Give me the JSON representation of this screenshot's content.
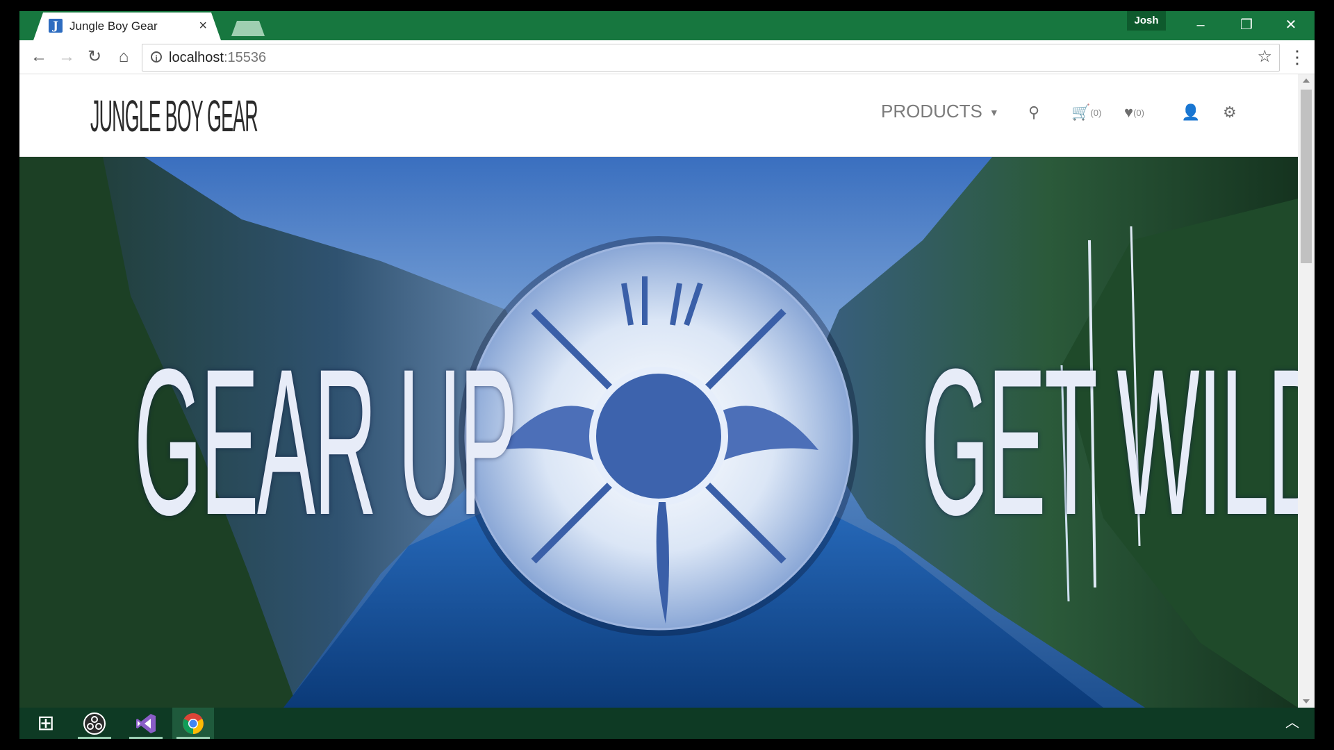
{
  "browser": {
    "tab_title": "Jungle Boy Gear",
    "tab_favicon_letter": "J",
    "tab_close": "×",
    "profile_name": "Josh",
    "url_host": "localhost",
    "url_port": ":15536",
    "window_controls": {
      "minimize": "–",
      "maximize": "❐",
      "close": "✕"
    }
  },
  "toolbar_icons": {
    "back": "←",
    "forward": "→",
    "reload": "↻",
    "home": "⌂",
    "info": "i",
    "bookmark": "☆",
    "menu": "⋮"
  },
  "site": {
    "logo": "JUNGLE BOY GEAR",
    "nav": {
      "products_label": "PRODUCTS",
      "products_caret": "▼",
      "search_icon": "⚲",
      "cart_icon": "🛒",
      "cart_count": "(0)",
      "wishlist_icon": "♥",
      "wishlist_count": "(0)",
      "account_icon": "👤",
      "settings_icon": "⚙"
    }
  },
  "hero": {
    "left_text": "GEAR UP",
    "right_text": "GET WILD"
  },
  "taskbar": {
    "start_icon": "⊞",
    "tray_chevron": "︿",
    "apps": [
      "OBS",
      "Visual Studio",
      "Chrome"
    ]
  },
  "colors": {
    "chrome_frame": "#17773f",
    "taskbar": "#0e3a24",
    "hero_text": "#e7ecf8",
    "nav_text": "#7b7b7b"
  }
}
